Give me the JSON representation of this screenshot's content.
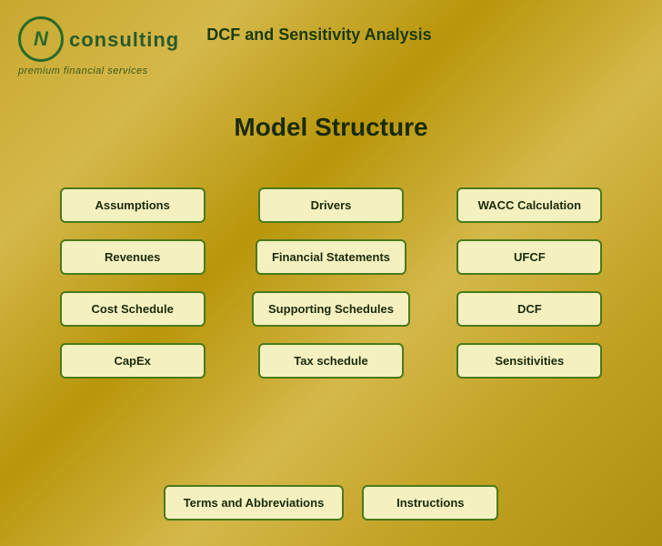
{
  "header": {
    "logo_letter": "N",
    "consulting_label": "consulting",
    "premium_label": "premium financial services",
    "title": "DCF and Sensitivity Analysis"
  },
  "main": {
    "title": "Model Structure"
  },
  "columns": [
    {
      "id": "col1",
      "buttons": [
        {
          "id": "assumptions",
          "label": "Assumptions"
        },
        {
          "id": "revenues",
          "label": "Revenues"
        },
        {
          "id": "cost-schedule",
          "label": "Cost Schedule"
        },
        {
          "id": "capex",
          "label": "CapEx"
        }
      ]
    },
    {
      "id": "col2",
      "buttons": [
        {
          "id": "drivers",
          "label": "Drivers"
        },
        {
          "id": "financial-statements",
          "label": "Financial Statements"
        },
        {
          "id": "supporting-schedules",
          "label": "Supporting Schedules"
        },
        {
          "id": "tax-schedule",
          "label": "Tax schedule"
        }
      ]
    },
    {
      "id": "col3",
      "buttons": [
        {
          "id": "wacc-calculation",
          "label": "WACC Calculation"
        },
        {
          "id": "ufcf",
          "label": "UFCF"
        },
        {
          "id": "dcf",
          "label": "DCF"
        },
        {
          "id": "sensitivities",
          "label": "Sensitivities"
        }
      ]
    }
  ],
  "bottom": {
    "terms_label": "Terms and Abbreviations",
    "instructions_label": "Instructions"
  }
}
